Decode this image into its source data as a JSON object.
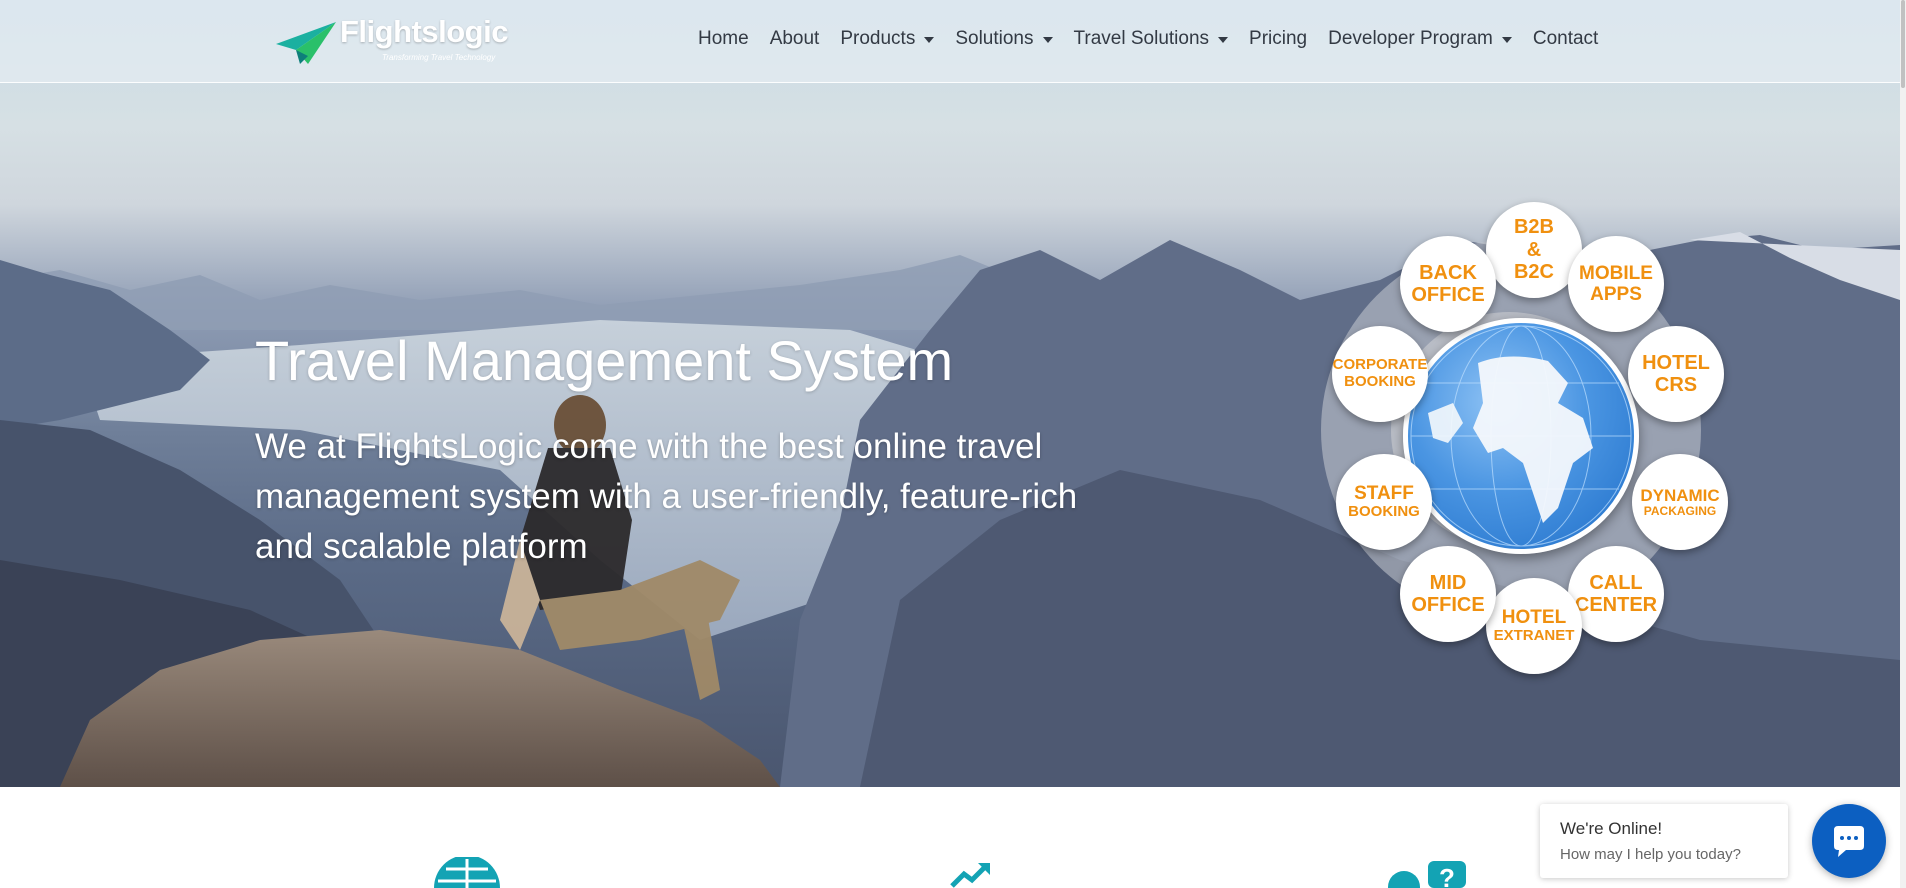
{
  "brand": {
    "name": "Flightslogic",
    "tagline": "Transforming Travel Technology"
  },
  "nav": {
    "items": [
      {
        "label": "Home",
        "dropdown": false
      },
      {
        "label": "About",
        "dropdown": false
      },
      {
        "label": "Products",
        "dropdown": true
      },
      {
        "label": "Solutions",
        "dropdown": true
      },
      {
        "label": "Travel Solutions",
        "dropdown": true
      },
      {
        "label": "Pricing",
        "dropdown": false
      },
      {
        "label": "Developer Program",
        "dropdown": true
      },
      {
        "label": "Contact",
        "dropdown": false
      }
    ]
  },
  "hero": {
    "title": "Travel Management System",
    "subtitle": "We at FlightsLogic come with the best online travel management system with a user-friendly, feature-rich and scalable platform"
  },
  "modules": [
    {
      "lines": [
        "B2B",
        "&",
        "B2C"
      ]
    },
    {
      "lines": [
        "MOBILE",
        "APPS"
      ]
    },
    {
      "lines": [
        "HOTEL",
        "CRS"
      ]
    },
    {
      "lines": [
        "DYNAMIC",
        "PACKAGING"
      ]
    },
    {
      "lines": [
        "CALL",
        "CENTER"
      ]
    },
    {
      "lines": [
        "HOTEL",
        "EXTRANET"
      ]
    },
    {
      "lines": [
        "MID",
        "OFFICE"
      ]
    },
    {
      "lines": [
        "STAFF",
        "BOOKING"
      ]
    },
    {
      "lines": [
        "CORPORATE",
        "BOOKING"
      ]
    },
    {
      "lines": [
        "BACK",
        "OFFICE"
      ]
    }
  ],
  "chat": {
    "title": "We're Online!",
    "subtitle": "How may I help you today?"
  },
  "colors": {
    "module_text": "#f0900f",
    "teal_icon": "#13a3b4",
    "chat_button": "#0c5fc1"
  }
}
